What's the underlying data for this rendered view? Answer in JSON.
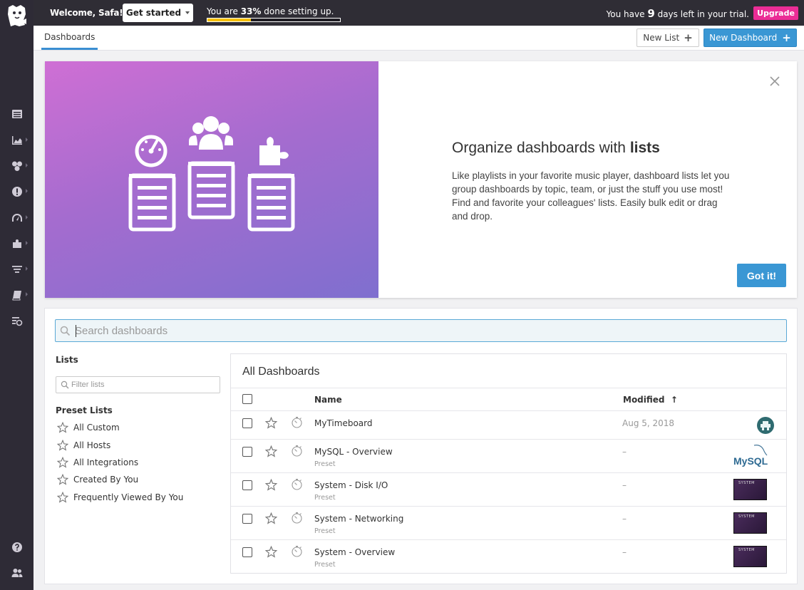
{
  "topbar": {
    "welcome": "Welcome, Safa!",
    "get_started": "Get started",
    "setup_prefix": "You are ",
    "setup_percent": "33%",
    "setup_suffix": " done setting up.",
    "setup_progress": 0.33,
    "trial_prefix": "You have ",
    "trial_days": "9",
    "trial_suffix": " days left in your trial.",
    "upgrade": "Upgrade"
  },
  "nav": {
    "icons": [
      "list-icon",
      "chart-icon",
      "hexagons-icon",
      "alert-icon",
      "gauge-icon",
      "puzzle-icon",
      "filter-icon",
      "book-icon",
      "logs-icon",
      "help-icon",
      "team-icon"
    ]
  },
  "subheader": {
    "tab": "Dashboards",
    "new_list": "New List",
    "new_dashboard": "New Dashboard"
  },
  "promo": {
    "title_prefix": "Organize dashboards with ",
    "title_bold": "lists",
    "body": "Like playlists in your favorite music player, dashboard lists let you group dashboards by topic, team, or just the stuff you use most! Find and favorite your colleagues' lists. Easily bulk edit or drag and drop.",
    "got_it": "Got it!"
  },
  "search": {
    "placeholder": "Search dashboards"
  },
  "lists": {
    "title": "Lists",
    "filter_placeholder": "Filter lists",
    "preset_title": "Preset Lists",
    "presets": [
      "All Custom",
      "All Hosts",
      "All Integrations",
      "Created By You",
      "Frequently Viewed By You"
    ]
  },
  "dashboards": {
    "title": "All Dashboards",
    "col_name": "Name",
    "col_modified": "Modified",
    "sort_arrow": "↑",
    "rows": [
      {
        "name": "MyTimeboard",
        "sub": "",
        "modified": "Aug 5, 2018",
        "thumb": "avatar"
      },
      {
        "name": "MySQL - Overview",
        "sub": "Preset",
        "modified": "–",
        "thumb": "mysql"
      },
      {
        "name": "System - Disk I/O",
        "sub": "Preset",
        "modified": "–",
        "thumb": "system"
      },
      {
        "name": "System - Networking",
        "sub": "Preset",
        "modified": "–",
        "thumb": "system"
      },
      {
        "name": "System - Overview",
        "sub": "Preset",
        "modified": "–",
        "thumb": "system"
      }
    ],
    "mysql_logo_text": "MySQL",
    "system_thumb_text": "SYSTEM"
  },
  "colors": {
    "accent": "#3a97d4",
    "upgrade": "#eb2d96",
    "progress": "#f6c000",
    "nav_bg": "#2e2b36"
  }
}
